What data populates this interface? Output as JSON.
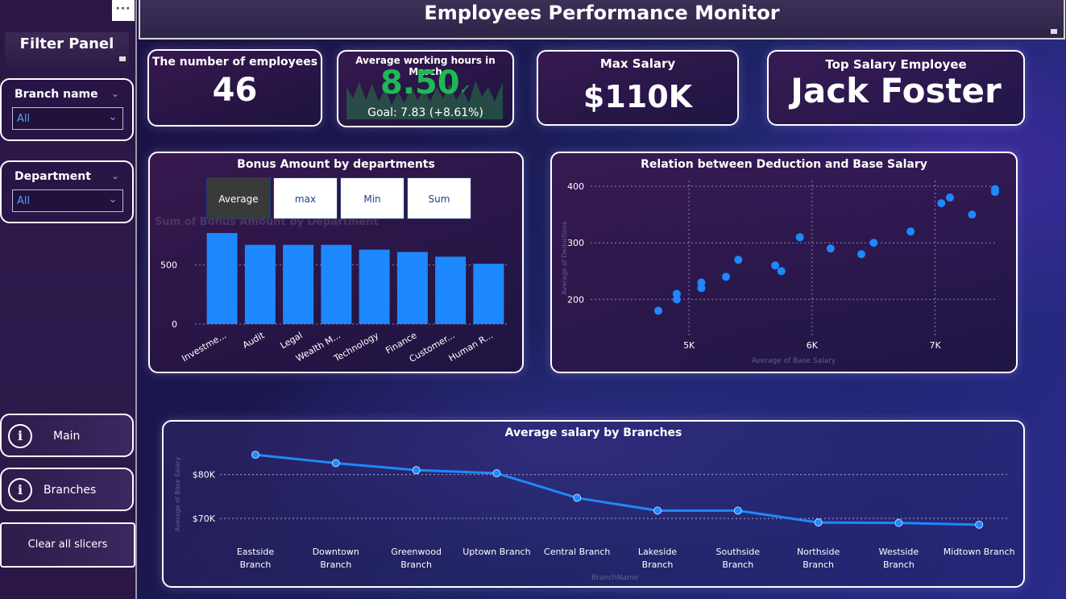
{
  "header": {
    "title": "Employees Performance Monitor"
  },
  "sidebar": {
    "more_label": "···",
    "filter_panel_label": "Filter Panel",
    "slicers": [
      {
        "title": "Branch name",
        "value": "All"
      },
      {
        "title": "Department",
        "value": "All"
      }
    ],
    "nav": [
      {
        "label": "Main",
        "icon": "info-icon"
      },
      {
        "label": "Branches",
        "icon": "info-icon"
      }
    ],
    "clear_label": "Clear all slicers"
  },
  "kpis": {
    "employees": {
      "title": "The number of employees",
      "value": "46"
    },
    "hours": {
      "title": "Average working hours in March",
      "value": "8.50",
      "goal": "Goal: 7.83 (+8.61%)",
      "check": "✓"
    },
    "max_salary": {
      "title": "Max Salary",
      "value": "$110K"
    },
    "top_employee": {
      "title": "Top Salary Employee",
      "value": "Jack Foster"
    }
  },
  "bonus_chart": {
    "title": "Bonus Amount by departments",
    "buttons": [
      "Average",
      "max",
      "Min",
      "Sum"
    ],
    "active_button": "Average",
    "ghost_title": "Sum of Bonus Amount by Department"
  },
  "colors": {
    "accent": "#1e88ff",
    "active_button": "#3a3a3a",
    "goal_green": "#1db954"
  },
  "chart_data": [
    {
      "type": "bar",
      "title": "Bonus Amount by departments",
      "categories": [
        "Investme...",
        "Audit",
        "Legal",
        "Wealth M...",
        "Technology",
        "Finance",
        "Customer...",
        "Human R..."
      ],
      "values": [
        770,
        670,
        670,
        670,
        630,
        610,
        570,
        510
      ],
      "ylim": [
        0,
        900
      ],
      "yticks": [
        "0",
        "500"
      ]
    },
    {
      "type": "scatter",
      "title": "Relation between Deduction and Base Salary",
      "xlabel": "Average of Base Salary",
      "ylabel": "Average of Deductions",
      "xlim": [
        4200,
        7500
      ],
      "ylim": [
        165,
        410
      ],
      "xticks": [
        "5K",
        "6K",
        "7K"
      ],
      "yticks": [
        "200",
        "300",
        "400"
      ],
      "points": [
        [
          4750,
          180
        ],
        [
          4900,
          210
        ],
        [
          4900,
          200
        ],
        [
          5100,
          230
        ],
        [
          5100,
          220
        ],
        [
          5300,
          240
        ],
        [
          5400,
          270
        ],
        [
          5700,
          260
        ],
        [
          5750,
          250
        ],
        [
          5900,
          310
        ],
        [
          6150,
          290
        ],
        [
          6400,
          280
        ],
        [
          6500,
          300
        ],
        [
          6800,
          320
        ],
        [
          7050,
          370
        ],
        [
          7120,
          380
        ],
        [
          7300,
          350
        ],
        [
          7500,
          395
        ],
        [
          7500,
          390
        ]
      ]
    },
    {
      "type": "line",
      "title": "Average salary by Branches",
      "xlabel": "BranchName",
      "ylabel": "Average of Base Salary",
      "categories": [
        "Eastside Branch",
        "Downtown Branch",
        "Greenwood Branch",
        "Uptown Branch",
        "Central Branch",
        "Lakeside Branch",
        "Southside Branch",
        "Northside Branch",
        "Westside Branch",
        "Midtown Branch"
      ],
      "values": [
        84500,
        82600,
        81000,
        80300,
        74700,
        71800,
        71800,
        69100,
        69000,
        68600
      ],
      "ylim": [
        66000,
        88000
      ],
      "yticks": [
        "$70K",
        "$80K"
      ]
    }
  ]
}
